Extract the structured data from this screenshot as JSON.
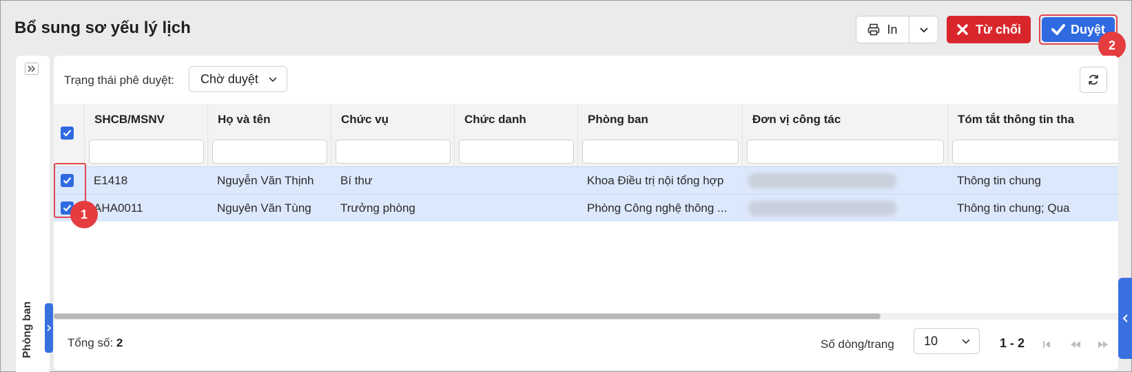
{
  "header": {
    "title": "Bổ sung sơ yếu lý lịch",
    "print_label": "In",
    "reject_label": "Từ chối",
    "approve_label": "Duyệt"
  },
  "markers": {
    "first": "1",
    "second": "2"
  },
  "sidebar": {
    "label": "Phòng ban"
  },
  "filter": {
    "label": "Trạng thái phê duyệt:",
    "selected": "Chờ duyệt"
  },
  "table": {
    "columns": [
      "SHCB/MSNV",
      "Họ và tên",
      "Chức vụ",
      "Chức danh",
      "Phòng ban",
      "Đơn vị công tác",
      "Tóm tắt thông tin tha"
    ],
    "rows": [
      {
        "code": "E1418",
        "name": "Nguyễn Văn Thịnh",
        "position": "Bí thư",
        "title": "",
        "department": "Khoa Điều trị nội tổng hợp",
        "summary": "Thông tin chung"
      },
      {
        "code": "AHA0011",
        "name": "Nguyên Văn Tùng",
        "position": "Trưởng phòng",
        "title": "",
        "department": "Phòng Công nghệ thông ...",
        "summary": "Thông tin chung; Qua"
      }
    ]
  },
  "footer": {
    "total_label": "Tổng số:",
    "total_value": "2",
    "rows_per_page_label": "Số dòng/trang",
    "rows_per_page": "10",
    "range": "1 - 2"
  },
  "colors": {
    "primary": "#2f6ae0",
    "danger": "#d9262c",
    "highlight": "#e2464b",
    "row_selected": "#dce8fb"
  }
}
